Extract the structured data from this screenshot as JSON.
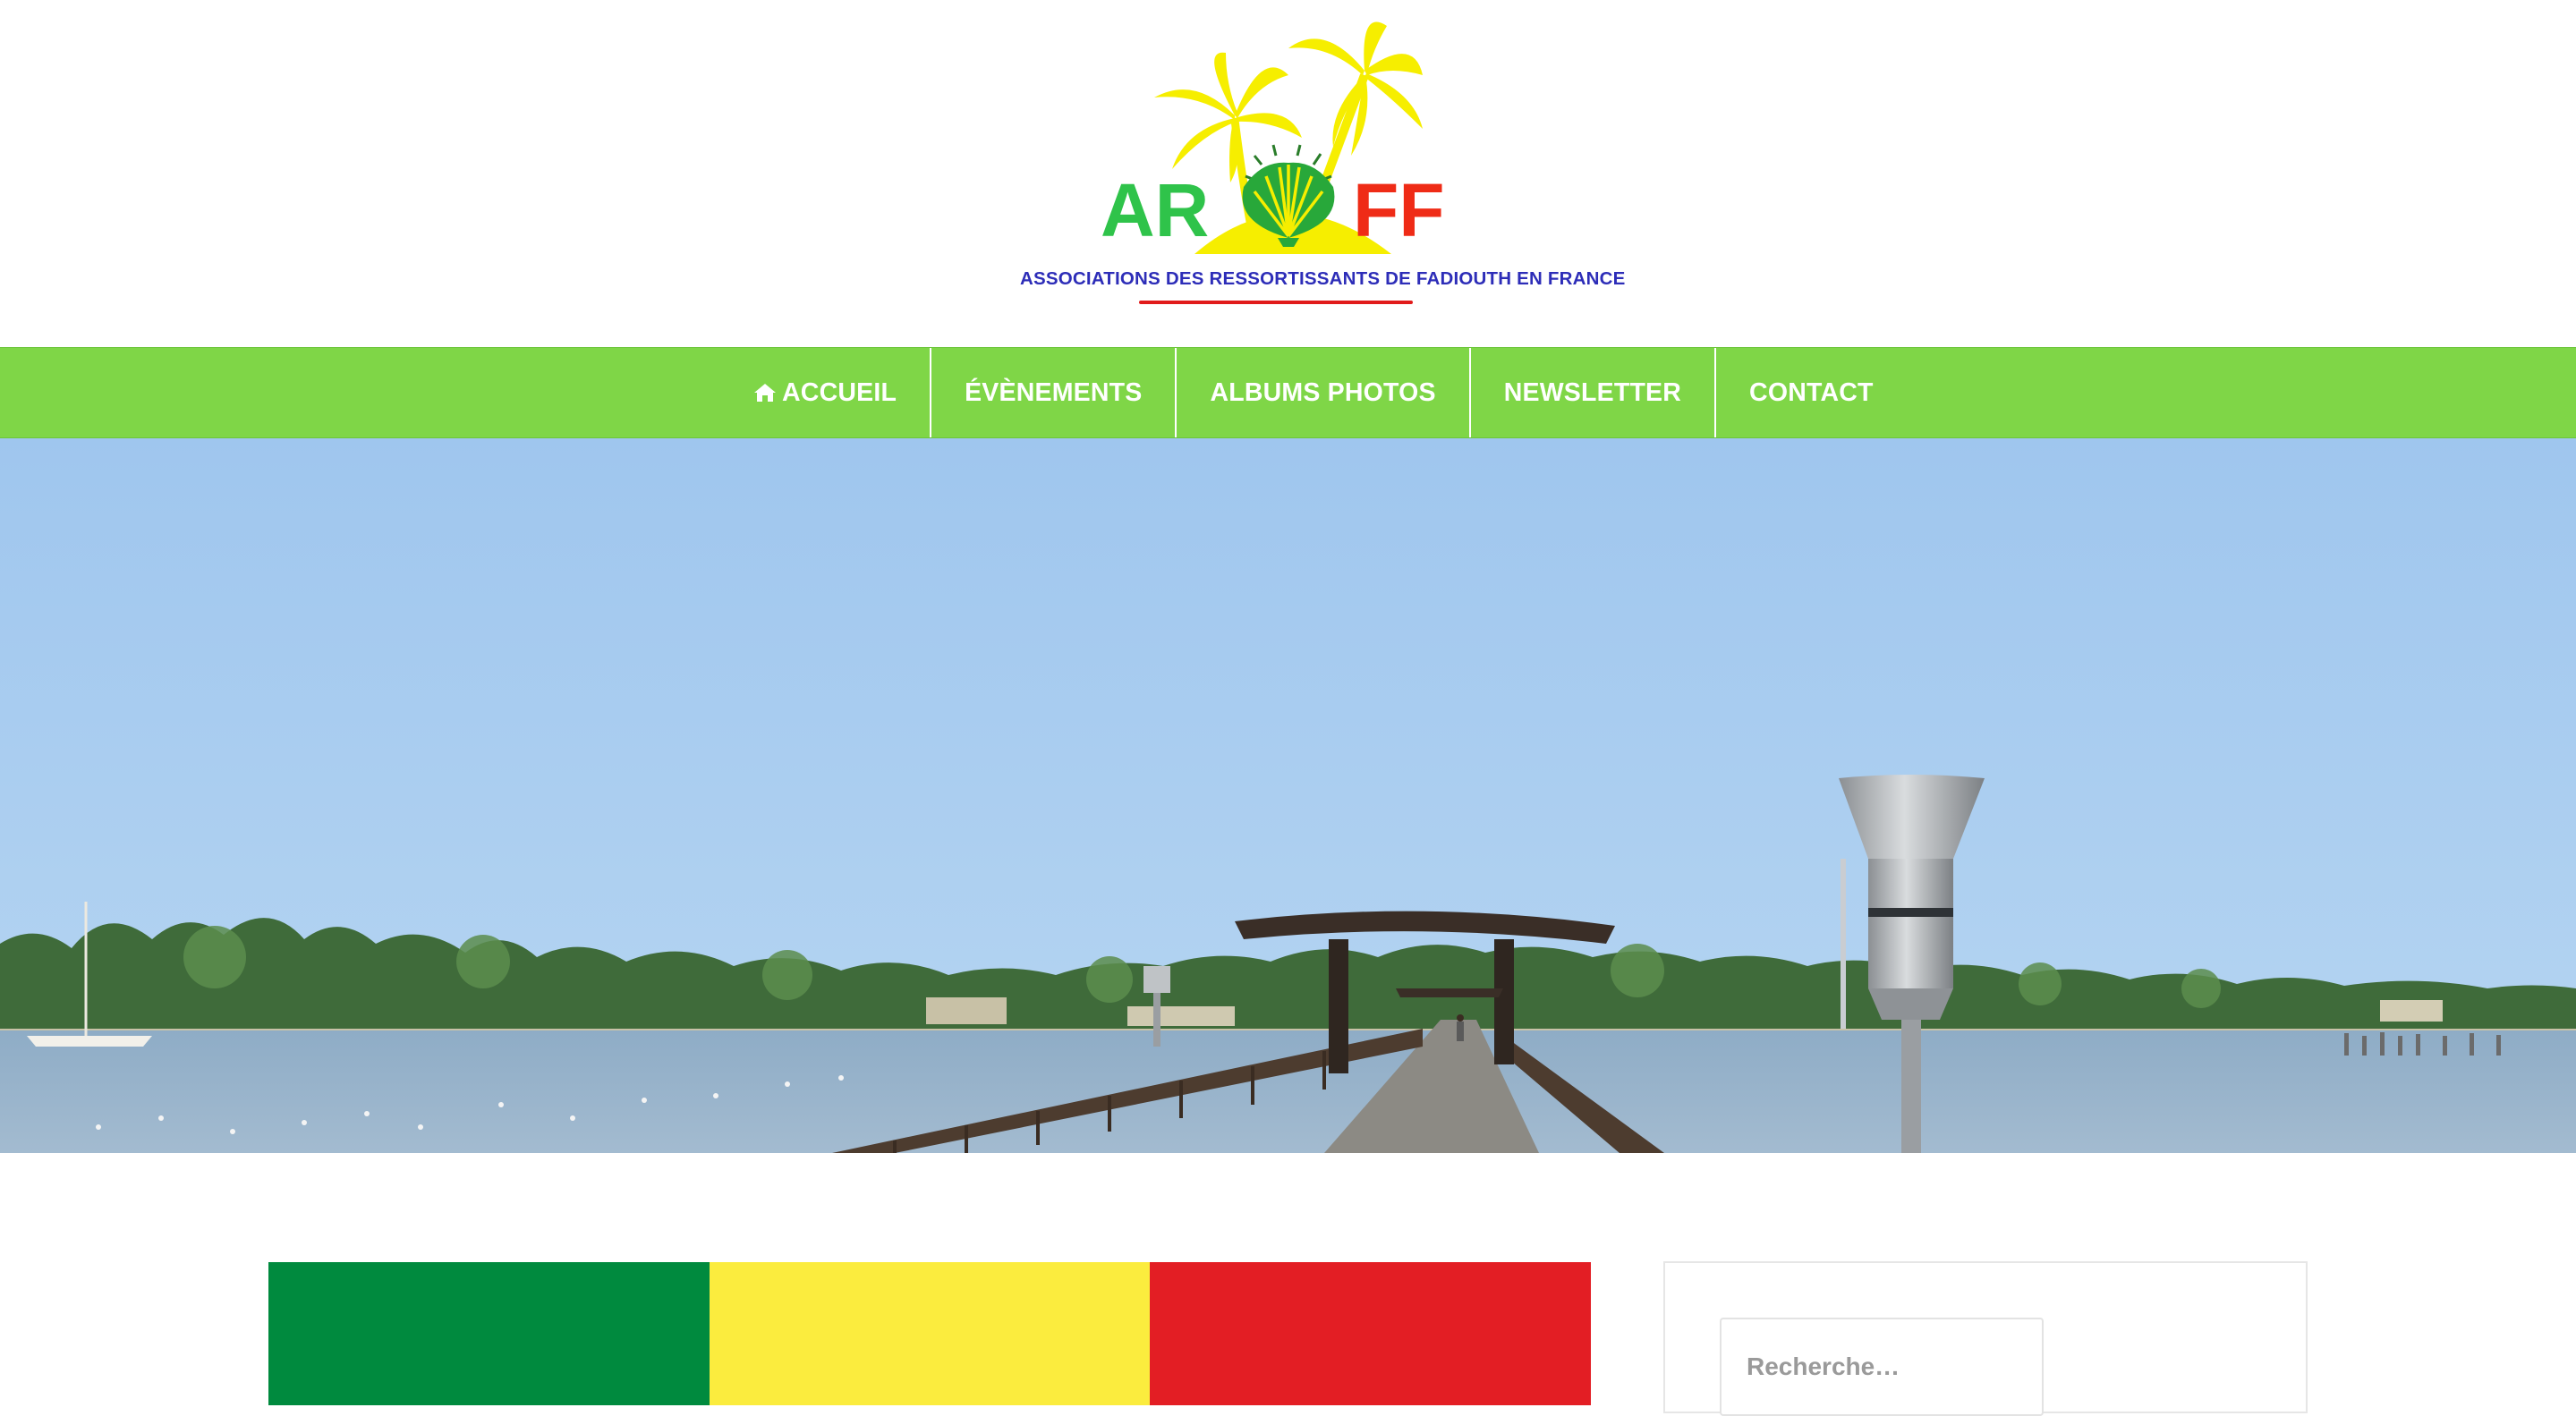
{
  "site": {
    "logo": {
      "name_left": "AR",
      "name_right": "FF",
      "tagline": "ASSOCIATIONS DES RESSORTISSANTS DE FADIOUTH EN FRANCE",
      "colors": {
        "green": "#2fc34a",
        "red": "#ef2b16",
        "yellow": "#f6ee00",
        "tagline": "#2d2db8"
      }
    }
  },
  "nav": {
    "background": "#7fd647",
    "items": [
      {
        "label": "ACCUEIL",
        "icon": "home-icon"
      },
      {
        "label": "ÉVÈNEMENTS"
      },
      {
        "label": "ALBUMS PHOTOS"
      },
      {
        "label": "NEWSLETTER"
      },
      {
        "label": "CONTACT"
      }
    ]
  },
  "hero": {
    "subject": "pier-over-lagoon-photo"
  },
  "content": {
    "flag_colors": [
      "#008a3e",
      "#fbec3e",
      "#e31e24"
    ]
  },
  "sidebar": {
    "search": {
      "placeholder": "Recherche…"
    }
  }
}
